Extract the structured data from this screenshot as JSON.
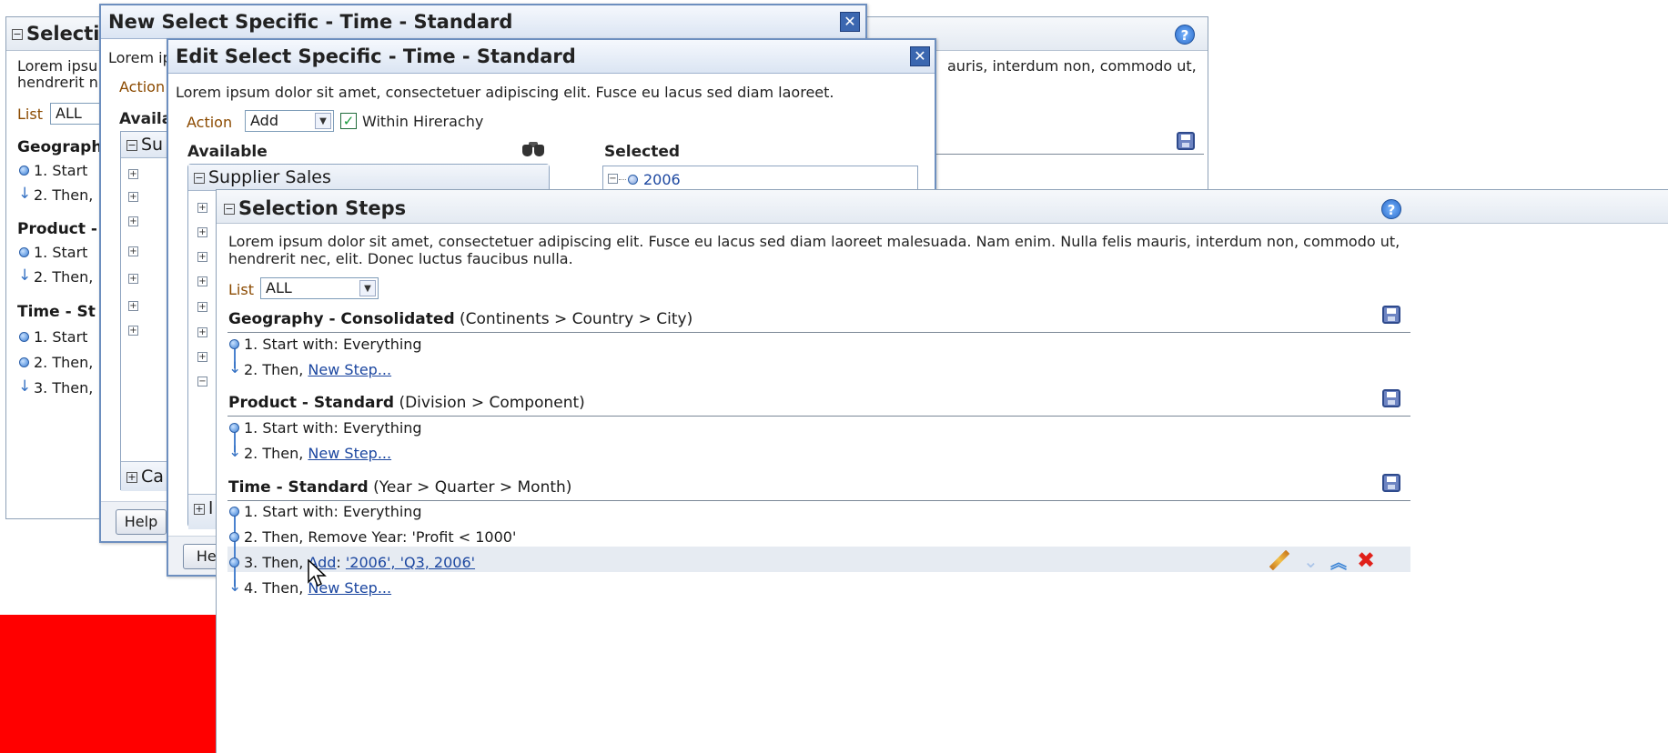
{
  "back_panel": {
    "title": "Selectio",
    "description_lines": [
      "Lorem ipsu",
      "hendrerit n"
    ],
    "list_label": "List",
    "list_value": "ALL",
    "sections": [
      {
        "name": "Geograph",
        "steps": [
          "1. Start",
          "2. Then,"
        ]
      },
      {
        "name": "Product -",
        "steps": [
          "1. Start",
          "2. Then,"
        ]
      },
      {
        "name": "Time - St",
        "steps": [
          "1. Start",
          "2. Then,",
          "3. Then,"
        ]
      }
    ],
    "right_text": "auris, interdum non, commodo ut,"
  },
  "new_dialog": {
    "title": "New Select Specific - Time - Standard",
    "description": "Lorem ip",
    "action_label": "Action",
    "available_label": "Availa",
    "tree_header": "Su",
    "category": "Ca",
    "help_button": "Help"
  },
  "edit_dialog": {
    "title": "Edit Select Specific - Time - Standard",
    "description": "Lorem ipsum dolor sit amet, consectetuer adipiscing elit. Fusce eu lacus sed diam laoreet.",
    "action_label": "Action",
    "action_value": "Add",
    "within_hierarchy": "Within Hirerachy",
    "available_label": "Available",
    "selected_label": "Selected",
    "tree_header": "Supplier Sales",
    "selected_item": "2006",
    "footer_tree_header": "l",
    "help_button": "Hel"
  },
  "front_panel": {
    "title": "Selection Steps",
    "description_line1": "Lorem ipsum dolor sit amet, consectetuer adipiscing elit. Fusce eu lacus sed diam laoreet malesuada. Nam enim. Nulla felis mauris, interdum non, commodo ut,",
    "description_line2": "hendrerit nec, elit. Donec luctus faucibus nulla.",
    "list_label": "List",
    "list_value": "ALL",
    "sections": [
      {
        "name": "Geography - Consolidated",
        "hierarchy": "(Continents > Country > City)",
        "steps": [
          {
            "prefix": "1. Start with: Everything",
            "link": ""
          },
          {
            "prefix": "2. Then, ",
            "link": "New Step..."
          }
        ]
      },
      {
        "name": "Product - Standard",
        "hierarchy": "(Division > Component)",
        "steps": [
          {
            "prefix": "1. Start with: Everything",
            "link": ""
          },
          {
            "prefix": "2. Then, ",
            "link": "New Step..."
          }
        ]
      },
      {
        "name": "Time - Standard",
        "hierarchy": "(Year > Quarter > Month)",
        "steps": [
          {
            "prefix": "1. Start with: Everything",
            "link": ""
          },
          {
            "prefix": "2. Then, Remove Year: 'Profit < 1000'",
            "link": ""
          },
          {
            "prefix": "3. Then, ",
            "link": "Add",
            "suffix": ": ",
            "link2": "'2006', 'Q3, 2006'"
          },
          {
            "prefix": "4. Then, ",
            "link": "New Step..."
          }
        ]
      }
    ]
  },
  "icons": {
    "help": "help-icon",
    "save": "save-icon",
    "edit": "pencil-icon",
    "move_down": "chevron-down-icon",
    "move_up": "chevron-up-icon",
    "delete": "delete-x-icon",
    "close": "close-icon",
    "search": "binoculars-icon"
  },
  "colors": {
    "accent_blue": "#3b67b0",
    "link": "#1c47a0",
    "brand_red": "#ff0000",
    "label_orange": "#8b4a00"
  }
}
